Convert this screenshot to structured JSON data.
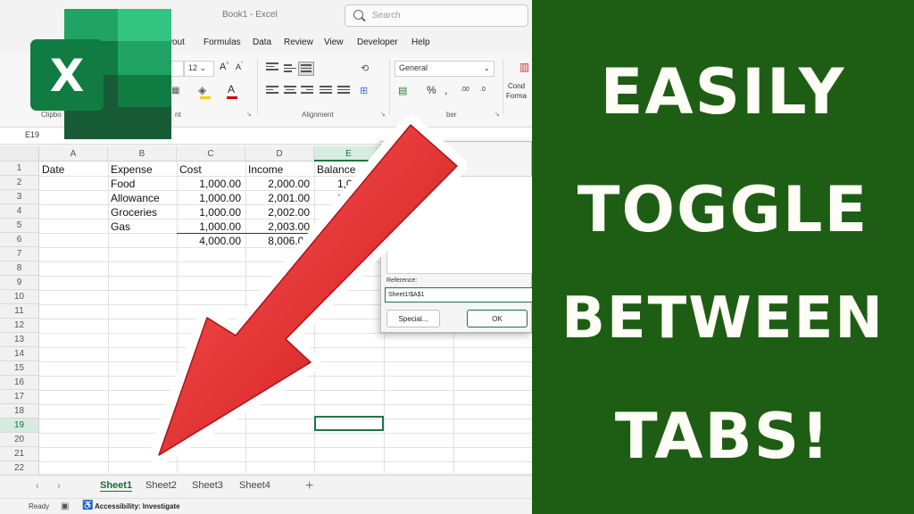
{
  "window": {
    "title": "Book1 - Excel",
    "search_placeholder": "Search"
  },
  "menu": [
    "yout",
    "Formulas",
    "Data",
    "Review",
    "View",
    "Developer",
    "Help"
  ],
  "ribbon": {
    "font_size": "12",
    "number_format": "General",
    "groups": [
      "Clipbo",
      "nt",
      "Alignment",
      "ber"
    ],
    "cond_format_label_1": "Cond",
    "cond_format_label_2": "Forma"
  },
  "formula_bar": {
    "name_box": "E19"
  },
  "grid": {
    "columns": [
      "A",
      "B",
      "C",
      "D",
      "E"
    ],
    "rows": [
      "1",
      "2",
      "3",
      "4",
      "5",
      "6",
      "7",
      "8",
      "9",
      "10",
      "11",
      "12",
      "13",
      "14",
      "15",
      "16",
      "17",
      "18",
      "19",
      "20",
      "21",
      "22"
    ],
    "headers": {
      "date": "Date",
      "expense": "Expense",
      "cost": "Cost",
      "income": "Income",
      "balance": "Balance"
    },
    "data": [
      {
        "expense": "Food",
        "cost": "1,000.00",
        "income": "2,000.00",
        "balance": "1,000"
      },
      {
        "expense": "Allowance",
        "cost": "1,000.00",
        "income": "2,001.00",
        "balance": "1,0"
      },
      {
        "expense": "Groceries",
        "cost": "1,000.00",
        "income": "2,002.00",
        "balance": ""
      },
      {
        "expense": "Gas",
        "cost": "1,000.00",
        "income": "2,003.00",
        "balance": ""
      }
    ],
    "totals": {
      "cost": "4,000.00",
      "income": "8,006.00"
    }
  },
  "dialog": {
    "reference_label": "Reference:",
    "reference_value": "Sheet1!$A$1",
    "special_button": "Special...",
    "ok_button": "OK"
  },
  "sheets": [
    "Sheet1",
    "Sheet2",
    "Sheet3",
    "Sheet4"
  ],
  "add_sheet": "+",
  "status": {
    "ready": "Ready",
    "accessibility": "Accessibility: Investigate"
  },
  "logo_letter": "X",
  "headline": [
    "EASILY",
    "TOGGLE",
    "BETWEEN",
    "TABS!"
  ],
  "colors": {
    "panel_green": "#1d5e14",
    "excel_green": "#217346",
    "arrow_red": "#e8262b",
    "headline_text": "#fffdf6"
  }
}
